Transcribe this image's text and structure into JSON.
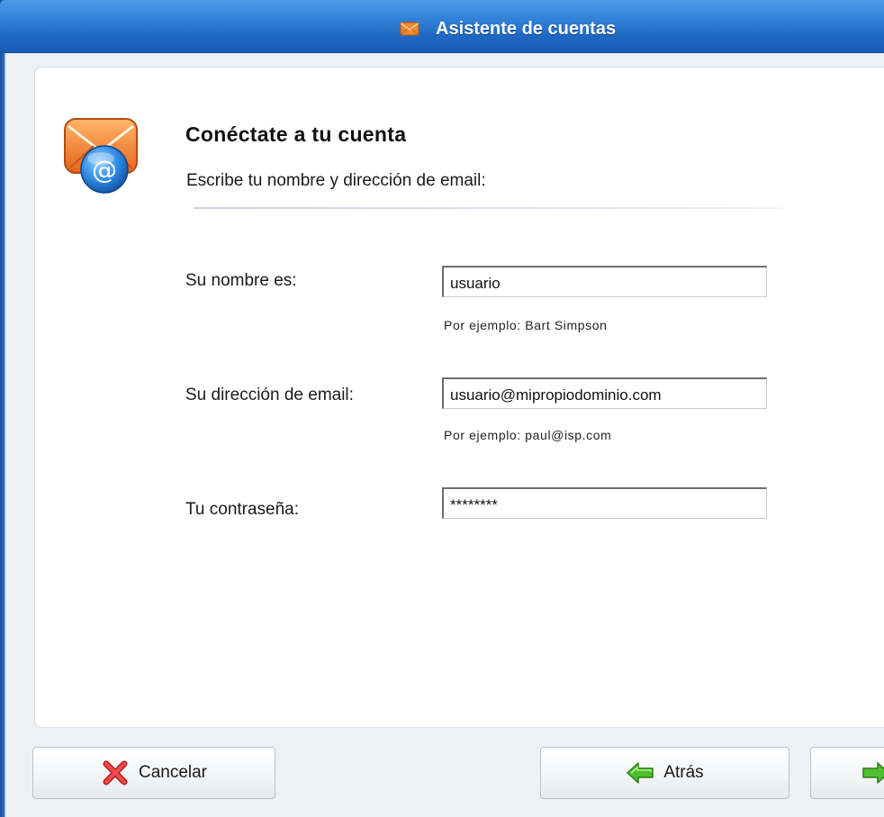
{
  "window": {
    "title": "Asistente de cuentas",
    "title_icon": "envelope-icon",
    "accent_color": "#2f7fd6"
  },
  "header": {
    "icon": "mail-at-icon",
    "title": "Conéctate a tu cuenta",
    "subtitle": "Escribe tu nombre y dirección de email:"
  },
  "form": {
    "name": {
      "label": "Su nombre es:",
      "value": "usuario",
      "hint": "Por ejemplo: Bart Simpson"
    },
    "email": {
      "label": "Su dirección de email:",
      "value": "usuario@mipropiodominio.com",
      "hint": "Por ejemplo: paul@isp.com"
    },
    "password": {
      "label": "Tu contraseña:",
      "value": "********"
    }
  },
  "buttons": {
    "cancel": {
      "label": "Cancelar",
      "icon": "red-x-icon"
    },
    "back": {
      "label": "Atrás",
      "icon": "green-left-arrow-icon"
    },
    "next": {
      "label": "",
      "icon": "green-right-arrow-icon"
    }
  }
}
